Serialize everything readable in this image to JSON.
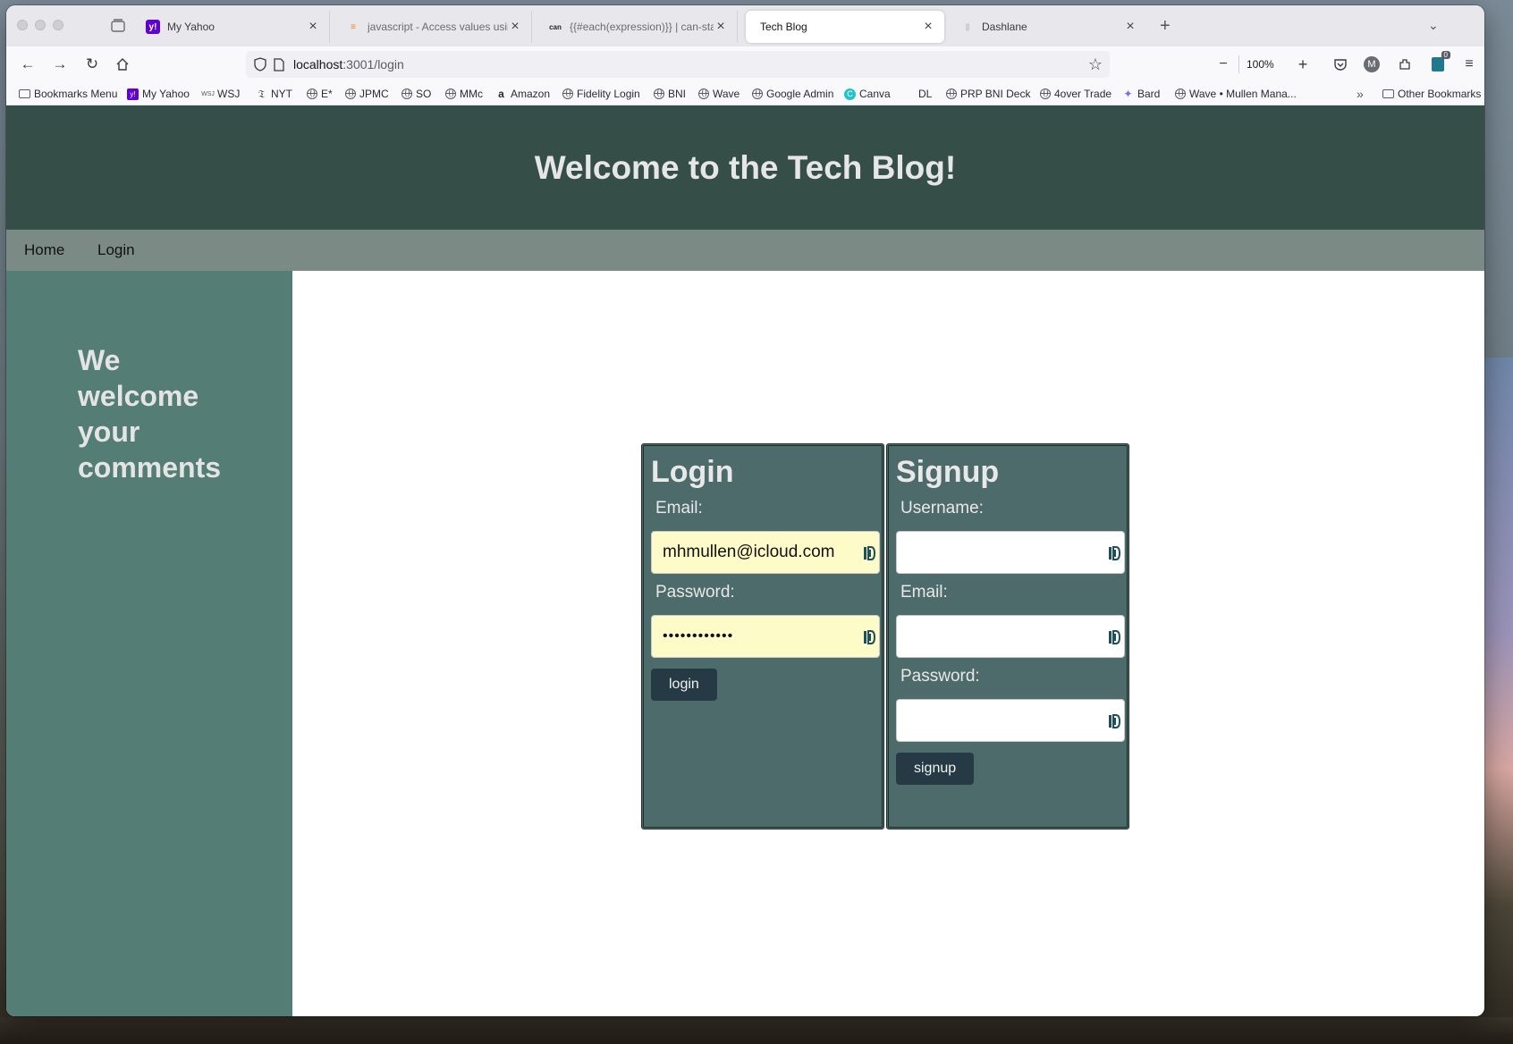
{
  "browser": {
    "tabs": [
      {
        "title": "My Yahoo",
        "favicon": "yahoo-icon",
        "active": false
      },
      {
        "title": "javascript - Access values using",
        "favicon": "stackoverflow-icon",
        "active": false
      },
      {
        "title": "{{#each(expression)}} | can-sta",
        "favicon": "canjs-icon",
        "active": false
      },
      {
        "title": "Tech Blog",
        "favicon": "",
        "active": true
      },
      {
        "title": "Dashlane",
        "favicon": "dashlane-icon",
        "active": false
      }
    ],
    "url_host": "localhost",
    "url_path": ":3001/login",
    "zoom": "100%",
    "extension_badge": "0",
    "profile_initial": "M"
  },
  "bookmarks": [
    {
      "label": "Bookmarks Menu",
      "icon": "folder-icon"
    },
    {
      "label": "My Yahoo",
      "icon": "yahoo-icon"
    },
    {
      "label": "WSJ",
      "icon": "wsj-icon"
    },
    {
      "label": "NYT",
      "icon": "nyt-icon"
    },
    {
      "label": "E*",
      "icon": "globe-icon"
    },
    {
      "label": "JPMC",
      "icon": "globe-icon"
    },
    {
      "label": "SO",
      "icon": "globe-icon"
    },
    {
      "label": "MMc",
      "icon": "globe-icon"
    },
    {
      "label": "Amazon",
      "icon": "amazon-icon"
    },
    {
      "label": "Fidelity Login",
      "icon": "globe-icon"
    },
    {
      "label": "BNI",
      "icon": "globe-icon"
    },
    {
      "label": "Wave",
      "icon": "globe-icon"
    },
    {
      "label": "Google Admin",
      "icon": "globe-icon"
    },
    {
      "label": "Canva",
      "icon": "canva-icon"
    },
    {
      "label": "DL",
      "icon": "none"
    },
    {
      "label": "PRP BNI Deck",
      "icon": "globe-icon"
    },
    {
      "label": "4over Trade",
      "icon": "globe-icon"
    },
    {
      "label": "Bard",
      "icon": "bard-icon"
    },
    {
      "label": "Wave • Mullen Mana...",
      "icon": "globe-icon"
    },
    {
      "label": "Other Bookmarks",
      "icon": "folder-icon"
    }
  ],
  "site": {
    "title": "Welcome to the Tech Blog!",
    "nav": [
      "Home",
      "Login"
    ],
    "sidebar_text": "We welcome your comments",
    "colors": {
      "header": "#354f48",
      "nav": "#7c8a85",
      "sidebar": "#537d75",
      "card": "#4e6b6b",
      "button": "#253a44",
      "autofill": "#fdfbc8"
    }
  },
  "login_form": {
    "heading": "Login",
    "email_label": "Email:",
    "email_value": "mhmullen@icloud.com",
    "password_label": "Password:",
    "password_value": "••••••••••••",
    "button": "login"
  },
  "signup_form": {
    "heading": "Signup",
    "username_label": "Username:",
    "username_value": "",
    "email_label": "Email:",
    "email_value": "",
    "password_label": "Password:",
    "password_value": "",
    "button": "signup"
  }
}
